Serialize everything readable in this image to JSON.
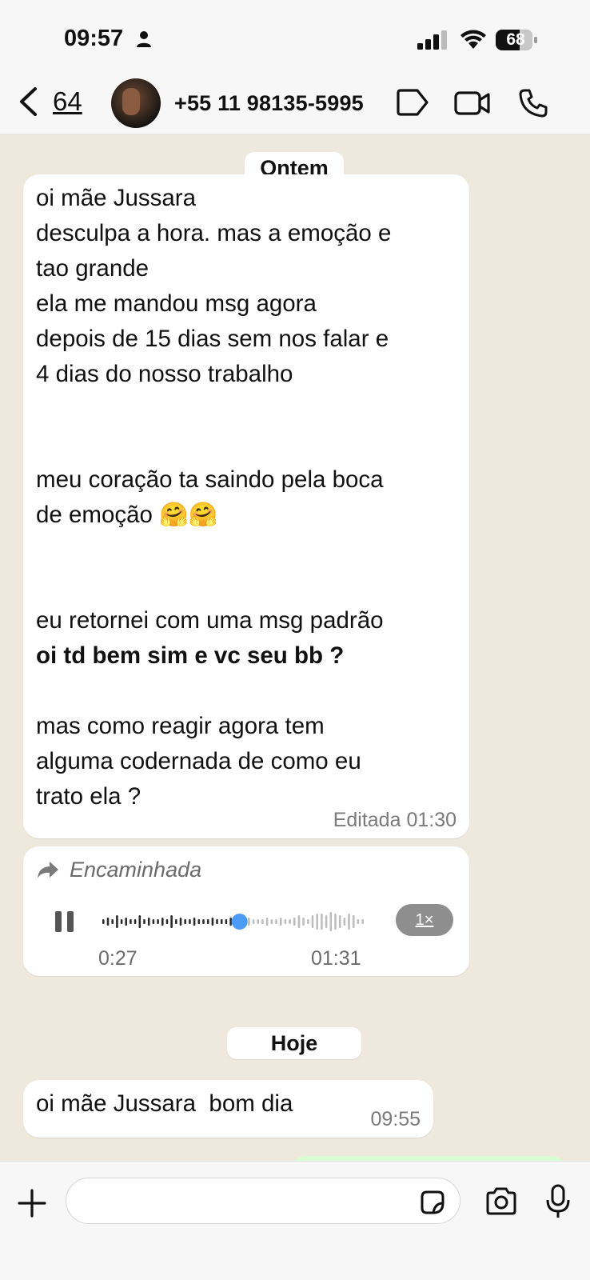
{
  "status_bar": {
    "time": "09:57",
    "battery": "68"
  },
  "header": {
    "back_count": "64",
    "contact_name": "+55 11 98135-5995",
    "icons": [
      "tag-icon",
      "video-call-icon",
      "phone-icon"
    ]
  },
  "chat": {
    "date_divider_1": "Ontem",
    "message_1": {
      "lines": [
        "oi mãe Jussara",
        "desculpa a hora. mas a emoção e",
        "tao grande",
        "ela me mandou msg agora",
        "depois de 15 dias sem nos falar e",
        "4 dias do nosso trabalho",
        "",
        "",
        "meu coração ta saindo pela boca",
        "de emoção 🤗🤗",
        "",
        "",
        "eu retornei com uma msg padrão",
        "oi td bem sim e vc seu bb ?",
        "",
        "mas como reagir agora tem",
        "alguma codernada de como eu",
        "trato ela ?"
      ],
      "bold_line_index": 13,
      "meta": "Editada 01:30"
    },
    "voice_message": {
      "forwarded_label": "Encaminhada",
      "elapsed": "0:27",
      "duration": "01:31",
      "speed": "1×",
      "progress": 0.52
    },
    "date_divider_2": "Hoje",
    "message_2": {
      "text": "oi mãe Jussara  bom dia",
      "time": "09:55"
    }
  },
  "composer": {
    "placeholder": ""
  }
}
